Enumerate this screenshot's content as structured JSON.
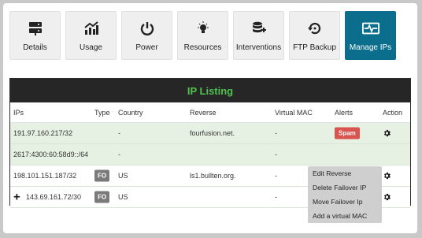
{
  "tabs": [
    {
      "label": "Details",
      "icon": "server-icon"
    },
    {
      "label": "Usage",
      "icon": "chart-icon"
    },
    {
      "label": "Power",
      "icon": "power-icon"
    },
    {
      "label": "Resources",
      "icon": "lightbulb-icon"
    },
    {
      "label": "Interventions",
      "icon": "database-add-icon"
    },
    {
      "label": "FTP Backup",
      "icon": "restore-icon"
    },
    {
      "label": "Manage IPs",
      "icon": "pulse-icon",
      "active": true
    }
  ],
  "panel": {
    "title": "IP Listing",
    "title_color": "#4fc24f",
    "columns": {
      "ips": "IPs",
      "type": "Type",
      "country": "Country",
      "reverse": "Reverse",
      "virtual_mac": "Virtual MAC",
      "alerts": "Alerts",
      "action": "Action"
    }
  },
  "rows": [
    {
      "ip": "191.97.160.217/32",
      "type": "",
      "country": "-",
      "reverse": "fourfusion.net.",
      "vmac": "-",
      "alert": "Spam"
    },
    {
      "ip": "2617:4300:60:58d9::/64",
      "type": "",
      "country": "-",
      "reverse": "",
      "vmac": "-",
      "alert": ""
    },
    {
      "ip": "198.101.151.187/32",
      "type": "FO",
      "country": "US",
      "reverse": "ls1.bullten.org.",
      "vmac": "-",
      "alert": ""
    },
    {
      "ip": "143.69.161.72/30",
      "type": "FO",
      "country": "US",
      "reverse": "",
      "vmac": "-",
      "alert": "",
      "expand": "+"
    }
  ],
  "context_menu": {
    "items": [
      "Edit Reverse",
      "Delete Failover IP",
      "Move Failover Ip",
      "Add a virtual MAC"
    ]
  },
  "colors": {
    "accent": "#0a6e8c",
    "spam": "#d9534f",
    "row_green": "#e7f1e3"
  }
}
